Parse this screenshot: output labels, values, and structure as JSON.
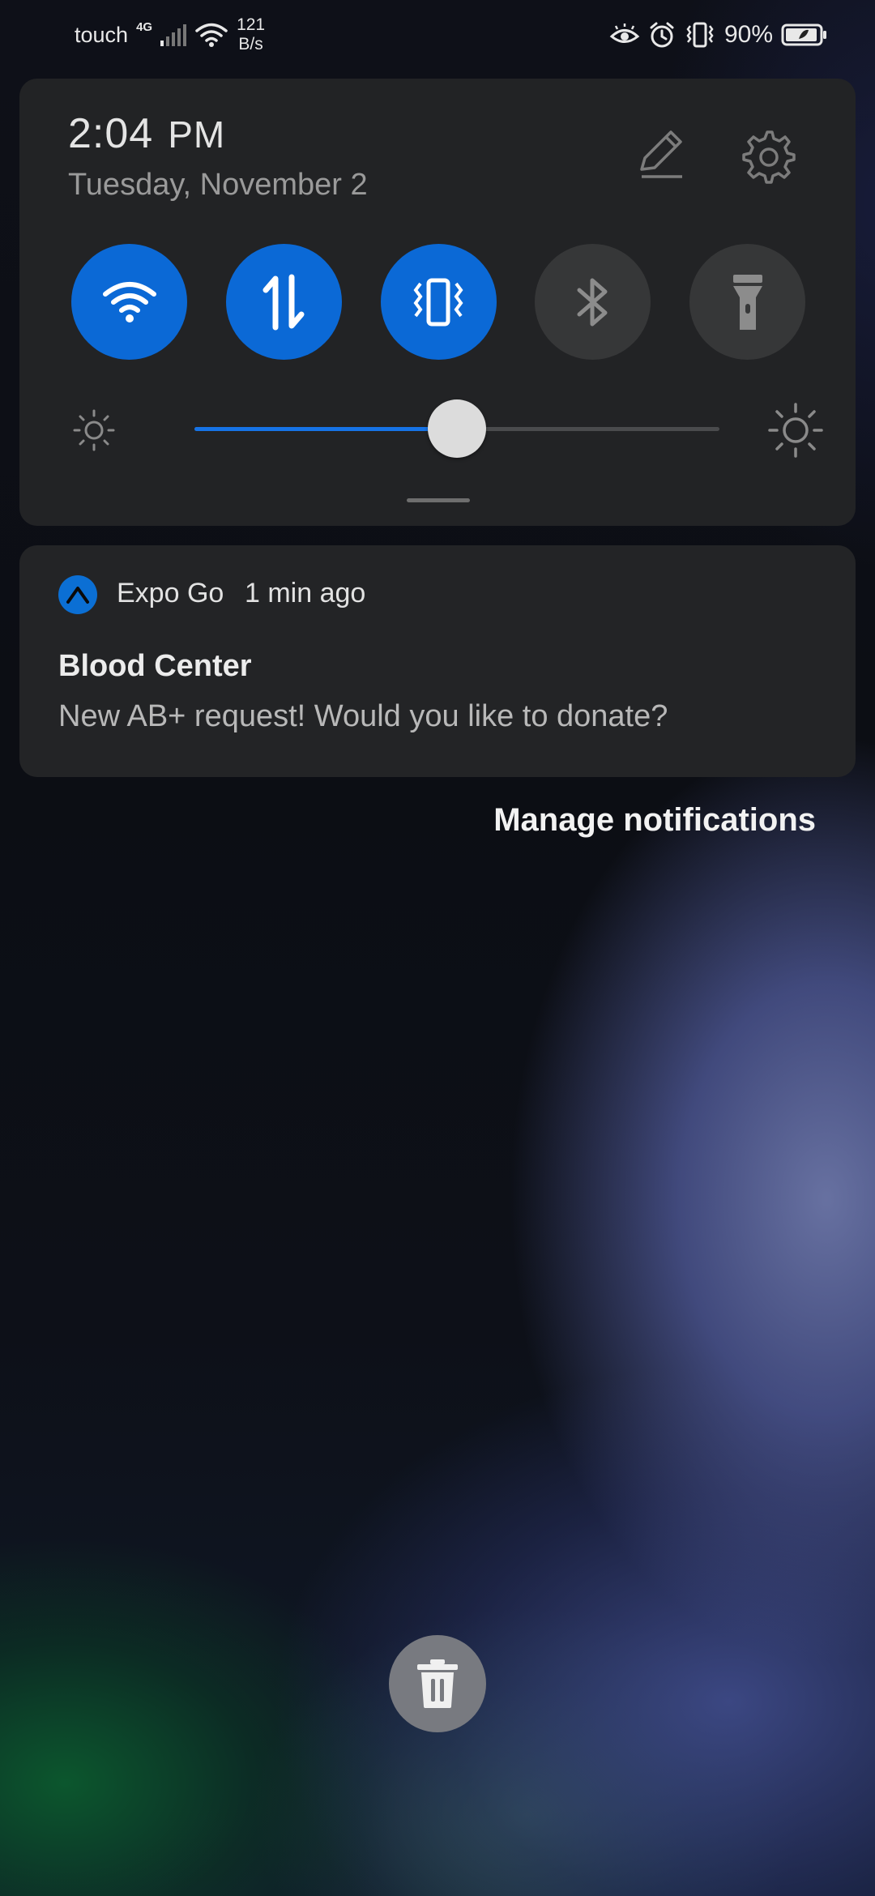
{
  "status_bar": {
    "carrier": "touch",
    "network_type": "4G",
    "speed_value": "121",
    "speed_unit": "B/s",
    "battery_percent": "90%",
    "icons": [
      "signal-icon",
      "wifi-icon",
      "eye-comfort-icon",
      "alarm-icon",
      "vibrate-icon",
      "battery-icon"
    ]
  },
  "quick_settings": {
    "time": "2:04",
    "ampm": "PM",
    "date": "Tuesday, November 2",
    "tiles": [
      {
        "name": "wifi",
        "icon": "wifi-icon",
        "active": true
      },
      {
        "name": "mobile-data",
        "icon": "data-transfer-icon",
        "active": true
      },
      {
        "name": "vibrate",
        "icon": "vibrate-icon",
        "active": true
      },
      {
        "name": "bluetooth",
        "icon": "bluetooth-icon",
        "active": false
      },
      {
        "name": "flashlight",
        "icon": "flashlight-icon",
        "active": false
      }
    ],
    "brightness_level": 0.5,
    "colors": {
      "active": "#0b69d6",
      "inactive": "#363738",
      "panel": "#222325"
    }
  },
  "notification": {
    "app_name": "Expo Go",
    "time_ago": "1 min ago",
    "title": "Blood Center",
    "body": "New AB+ request! Would you like to donate?",
    "app_icon": "expo-icon"
  },
  "manage_notifications_label": "Manage notifications",
  "clear_all_icon": "trash-icon"
}
